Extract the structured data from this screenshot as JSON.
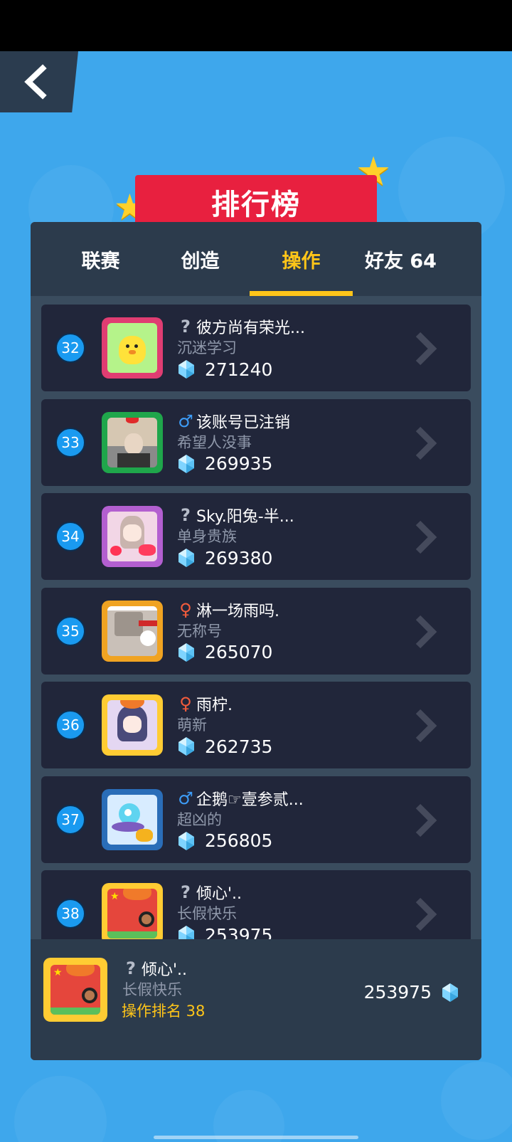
{
  "header": {
    "title": "排行榜"
  },
  "tabs": [
    {
      "label": "联赛",
      "active": false
    },
    {
      "label": "创造",
      "active": false
    },
    {
      "label": "操作",
      "active": true
    },
    {
      "label": "好友 64",
      "active": false
    }
  ],
  "rows": [
    {
      "rank": "32",
      "gender": "?",
      "gender_type": "unknown",
      "name": "彼方尚有荣光...",
      "title": "沉迷学习",
      "score": "271240",
      "avatar": "yellow-chick"
    },
    {
      "rank": "33",
      "gender": "♂",
      "gender_type": "male",
      "name": "该账号已注销",
      "title": "希望人没事",
      "score": "269935",
      "avatar": "christmas-frame-photo"
    },
    {
      "rank": "34",
      "gender": "?",
      "gender_type": "unknown",
      "name": "Sky.阳兔-半...",
      "title": "单身贵族",
      "score": "269380",
      "avatar": "anime-girl-love-hearts"
    },
    {
      "rank": "35",
      "gender": "♀",
      "gender_type": "female",
      "name": "淋一场雨吗.",
      "title": "无称号",
      "score": "265070",
      "avatar": "snowman-frame-photo"
    },
    {
      "rank": "36",
      "gender": "♀",
      "gender_type": "female",
      "name": "雨柠.",
      "title": "萌新",
      "score": "262735",
      "avatar": "anime-girl-yellow-frame"
    },
    {
      "rank": "37",
      "gender": "♂",
      "gender_type": "male",
      "name": "企鹅☞壹参贰...",
      "title": "超凶的",
      "score": "256805",
      "avatar": "alien-ufo-coins"
    },
    {
      "rank": "38",
      "gender": "?",
      "gender_type": "unknown",
      "name": "倾心'..",
      "title": "长假快乐",
      "score": "253975",
      "avatar": "flag-yellow-frame"
    }
  ],
  "me": {
    "gender": "?",
    "name": "倾心'..",
    "title": "长假快乐",
    "rank_label": "操作排名 38",
    "score": "253975",
    "avatar": "flag-yellow-frame"
  },
  "colors": {
    "background": "#3ea7ec",
    "panel": "#3a4c5e",
    "row": "#21263a",
    "accent": "#ffc519",
    "banner": "#e8203f",
    "rank_badge": "#1a9af0"
  },
  "icons": {
    "back": "chevron-left-icon",
    "gem": "diamond-gem-icon",
    "row_arrow": "chevron-right-icon",
    "star": "star-icon"
  }
}
